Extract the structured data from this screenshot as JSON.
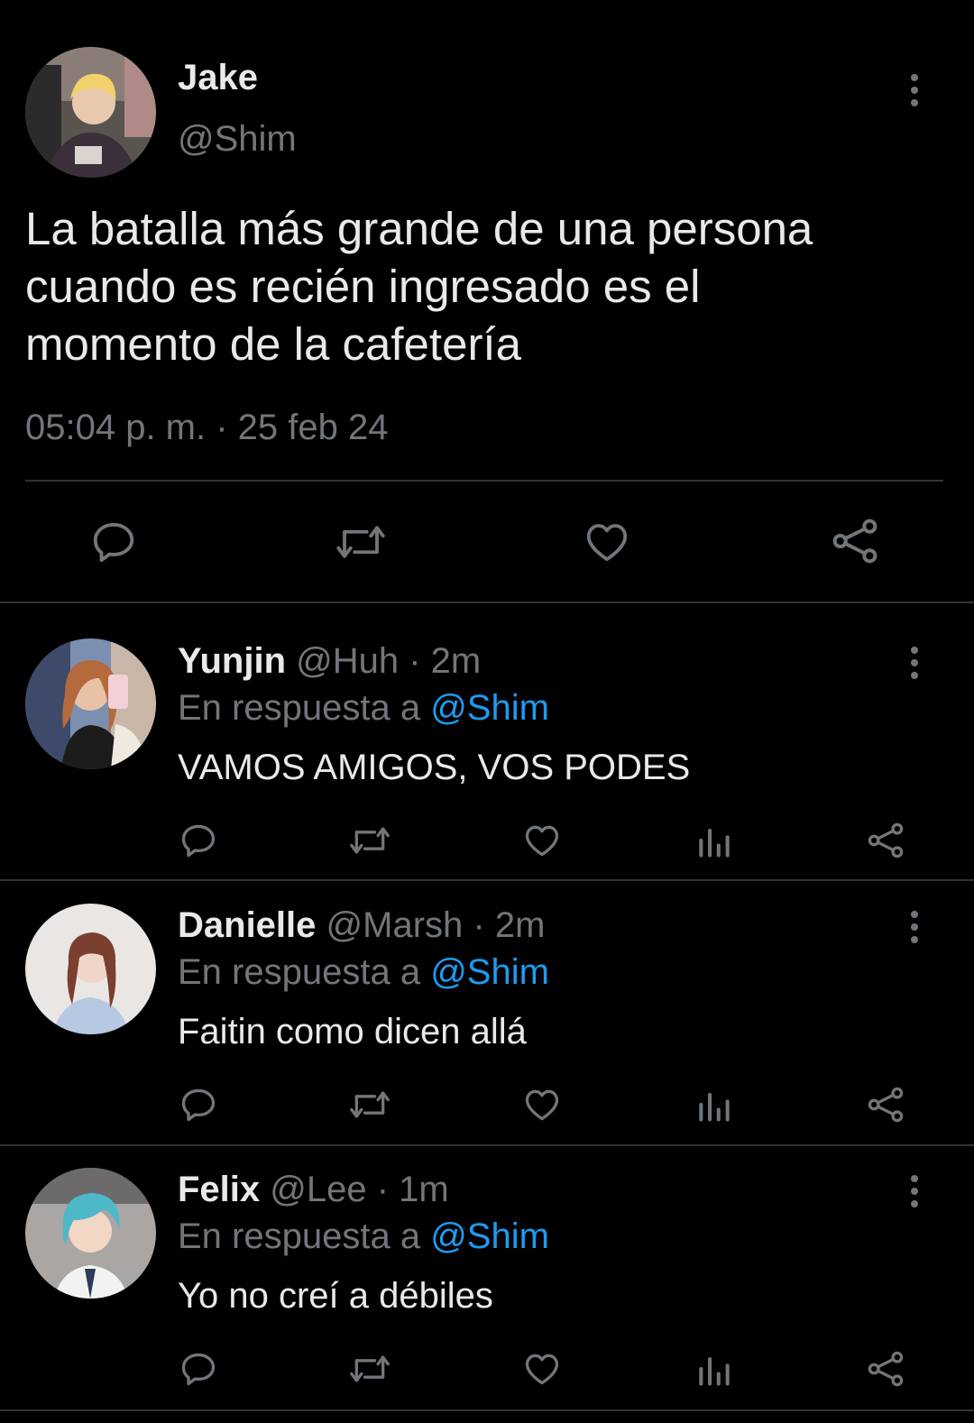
{
  "main_tweet": {
    "name": "Jake",
    "handle": "@Shim",
    "text_lines": [
      "La batalla más grande de una persona",
      "cuando es recién ingresado es el",
      "momento de la cafetería"
    ],
    "timestamp": "05:04 p. m. · 25 feb 24",
    "actions": [
      "reply-icon",
      "retweet-icon",
      "like-icon",
      "share-icon"
    ]
  },
  "replies": [
    {
      "name": "Yunjin",
      "handle": "@Huh",
      "time": "· 2m",
      "reply_prefix": "En respuesta a",
      "reply_to": "@Shim",
      "text": "VAMOS AMIGOS, VOS PODES"
    },
    {
      "name": "Danielle",
      "handle": "@Marsh",
      "time": "· 2m",
      "reply_prefix": "En respuesta a",
      "reply_to": "@Shim",
      "text": "Faitin como dicen allá"
    },
    {
      "name": "Felix",
      "handle": "@Lee",
      "time": "· 1m",
      "reply_prefix": "En respuesta a",
      "reply_to": "@Shim",
      "text": "Yo no creí a débiles"
    }
  ],
  "reply_actions": [
    "reply-icon",
    "retweet-icon",
    "like-icon",
    "views-icon",
    "share-icon"
  ],
  "colors": {
    "background": "#000000",
    "text": "#e7e9ea",
    "secondary": "#71767b",
    "link": "#1d9bf0",
    "divider": "#2f3336"
  }
}
